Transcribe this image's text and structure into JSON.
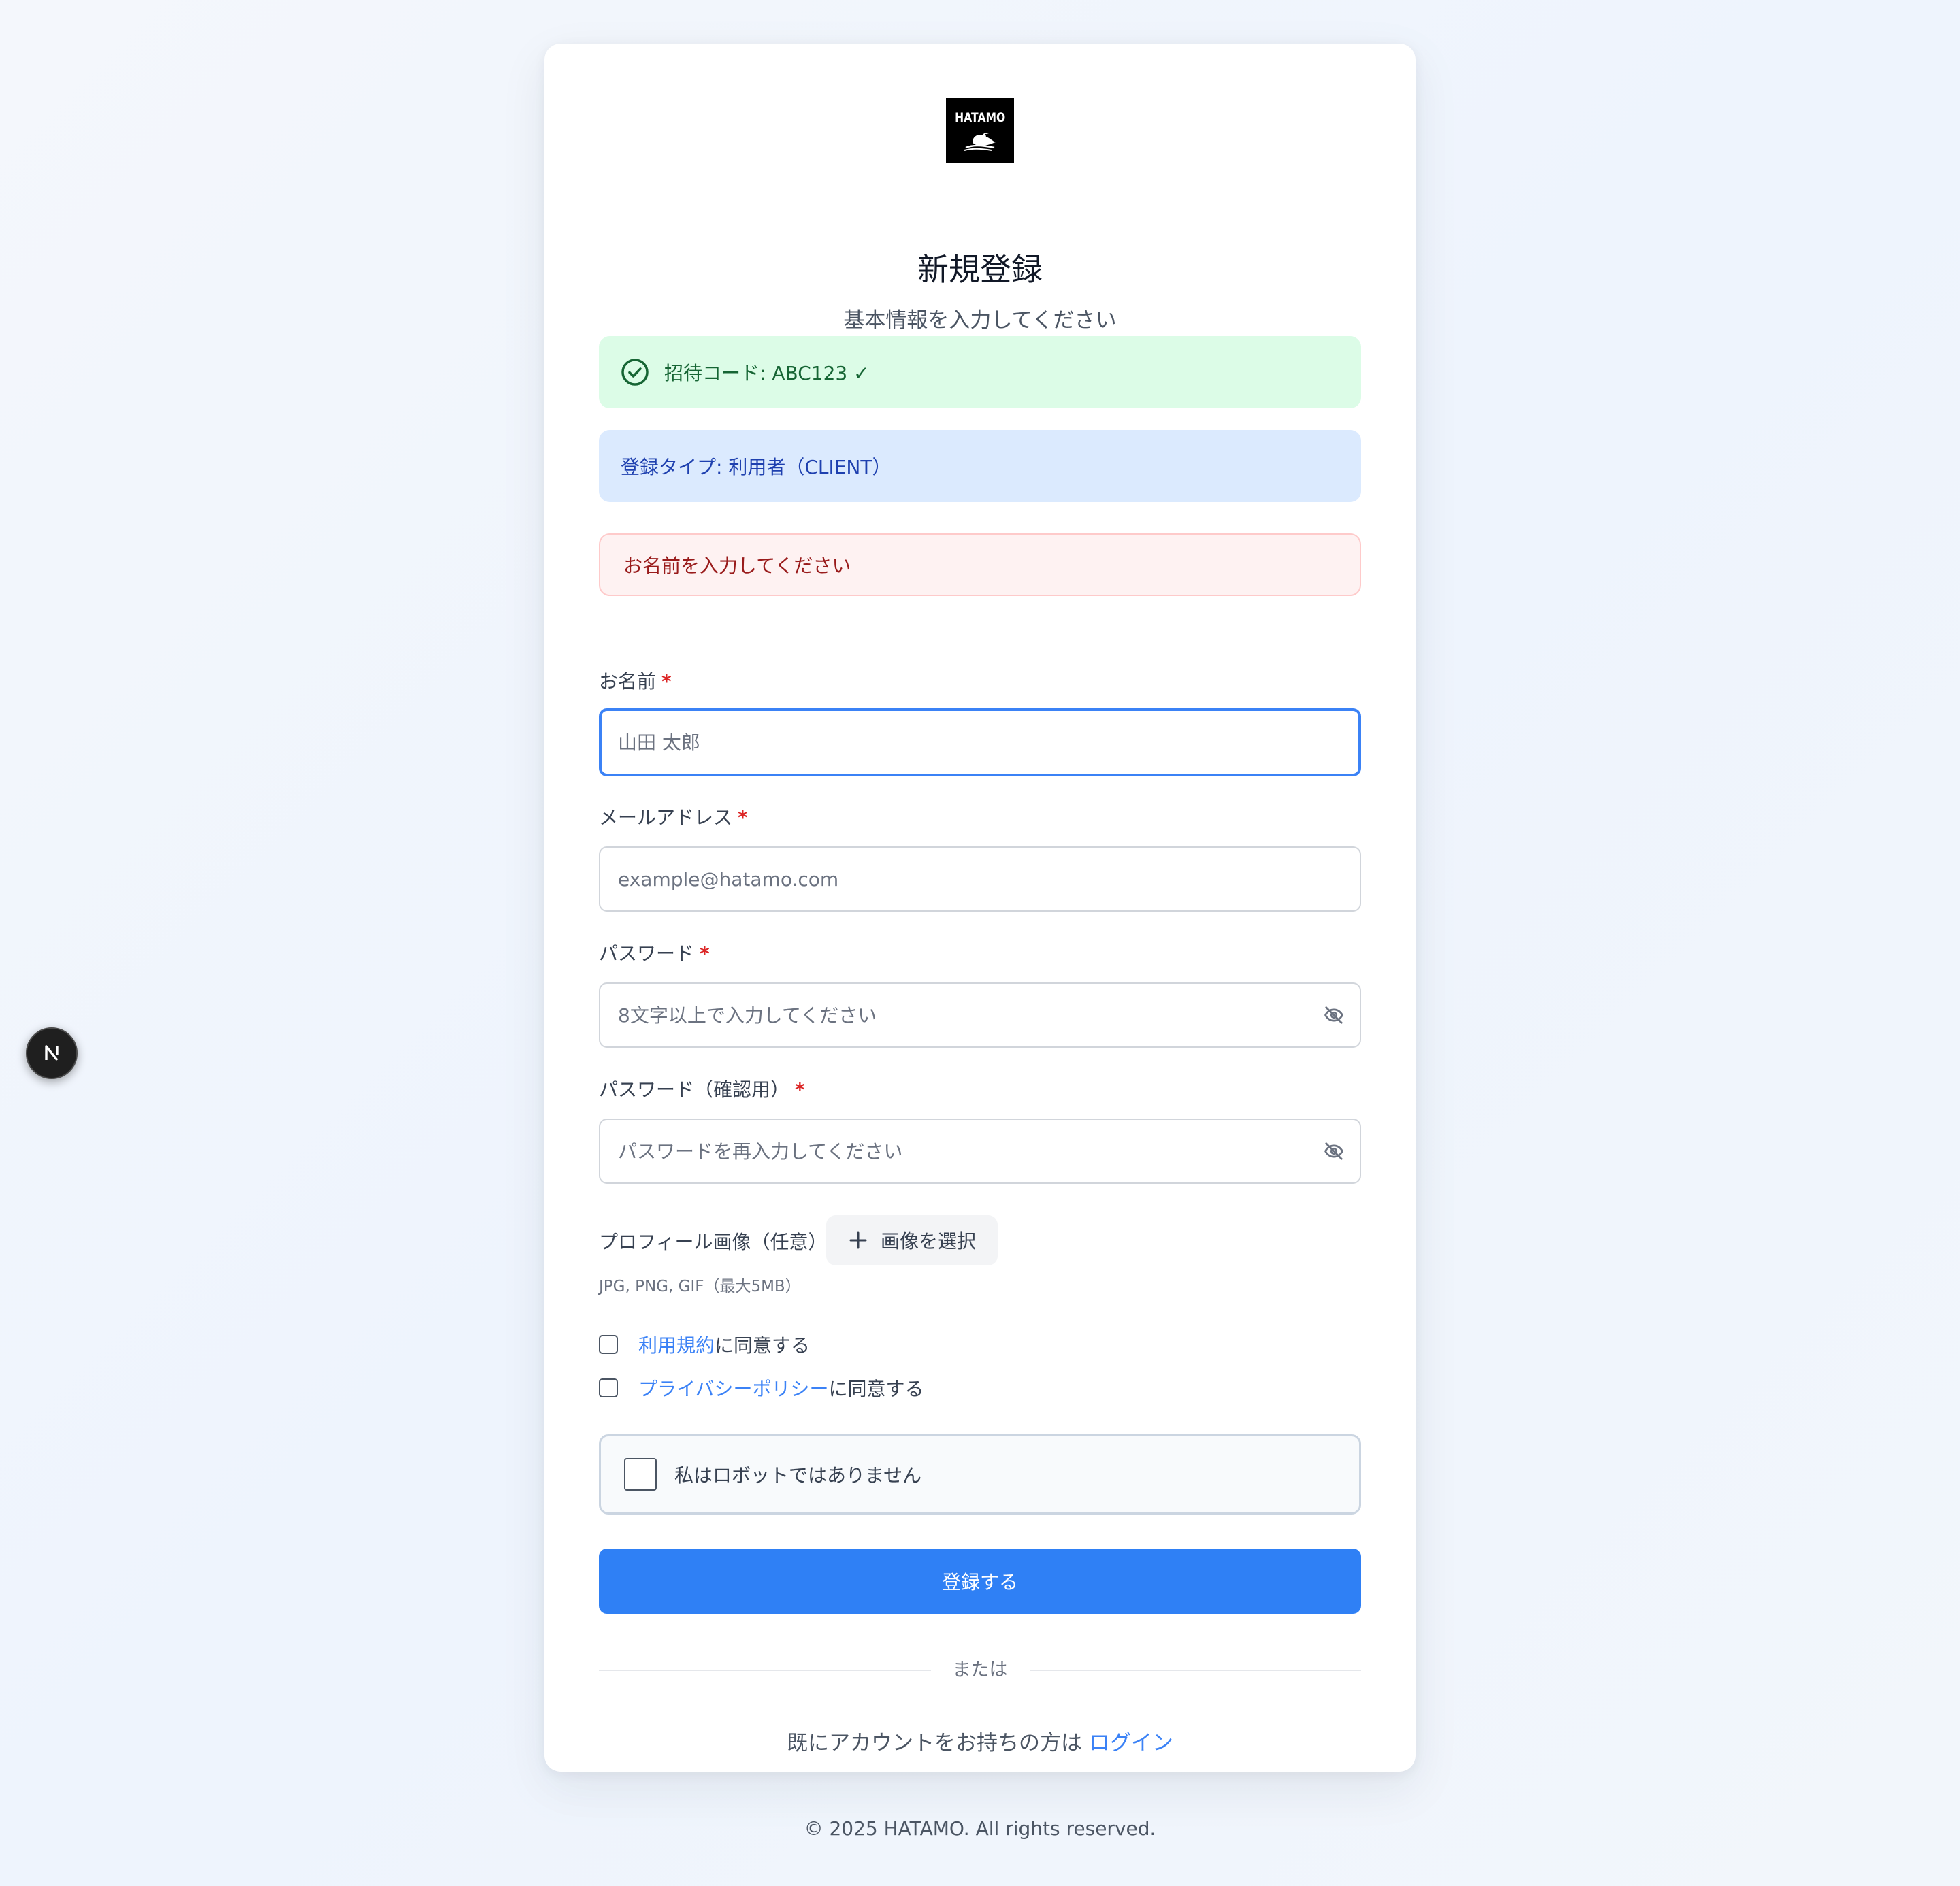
{
  "brand": {
    "logo_text": "HATAMO"
  },
  "header": {
    "title": "新規登録",
    "subtitle": "基本情報を入力してください"
  },
  "alerts": {
    "invite_code": "招待コード: ABC123 ✓",
    "registration_type": "登録タイプ: 利用者（CLIENT）",
    "error": "お名前を入力してください"
  },
  "form": {
    "name": {
      "label": "お名前",
      "required_mark": "*",
      "placeholder": "山田 太郎",
      "value": ""
    },
    "email": {
      "label": "メールアドレス",
      "required_mark": "*",
      "placeholder": "example@hatamo.com",
      "value": ""
    },
    "password": {
      "label": "パスワード",
      "required_mark": "*",
      "placeholder": "8文字以上で入力してください",
      "value": ""
    },
    "password_confirm": {
      "label": "パスワード（確認用）",
      "required_mark": "*",
      "placeholder": "パスワードを再入力してください",
      "value": ""
    },
    "profile_image": {
      "label": "プロフィール画像（任意）",
      "button_label": "画像を選択",
      "help_text": "JPG, PNG, GIF（最大5MB）"
    },
    "terms": {
      "link_text": "利用規約",
      "suffix": "に同意する",
      "checked": false
    },
    "privacy": {
      "link_text": "プライバシーポリシー",
      "suffix": "に同意する",
      "checked": false
    },
    "captcha": {
      "label": "私はロボットではありません",
      "checked": false
    },
    "submit_label": "登録する"
  },
  "divider_text": "または",
  "login_prompt": {
    "text": "既にアカウントをお持ちの方は",
    "link_text": "ログイン"
  },
  "copyright": "© 2025 HATAMO. All rights reserved.",
  "dev_badge": {
    "letter": "N"
  },
  "colors": {
    "primary": "#2f80f5",
    "success_bg": "#dcfce7",
    "success_text": "#166534",
    "info_bg": "#dbeafe",
    "info_text": "#1e40af",
    "error_bg": "#fef2f2",
    "error_text": "#991b1b",
    "required": "#dc2626",
    "link": "#3b82f6"
  },
  "icons": {
    "success": "check-circle-icon",
    "password_toggle": "eye-off-icon",
    "upload": "plus-icon",
    "dev_badge": "nextjs-logo-icon"
  }
}
